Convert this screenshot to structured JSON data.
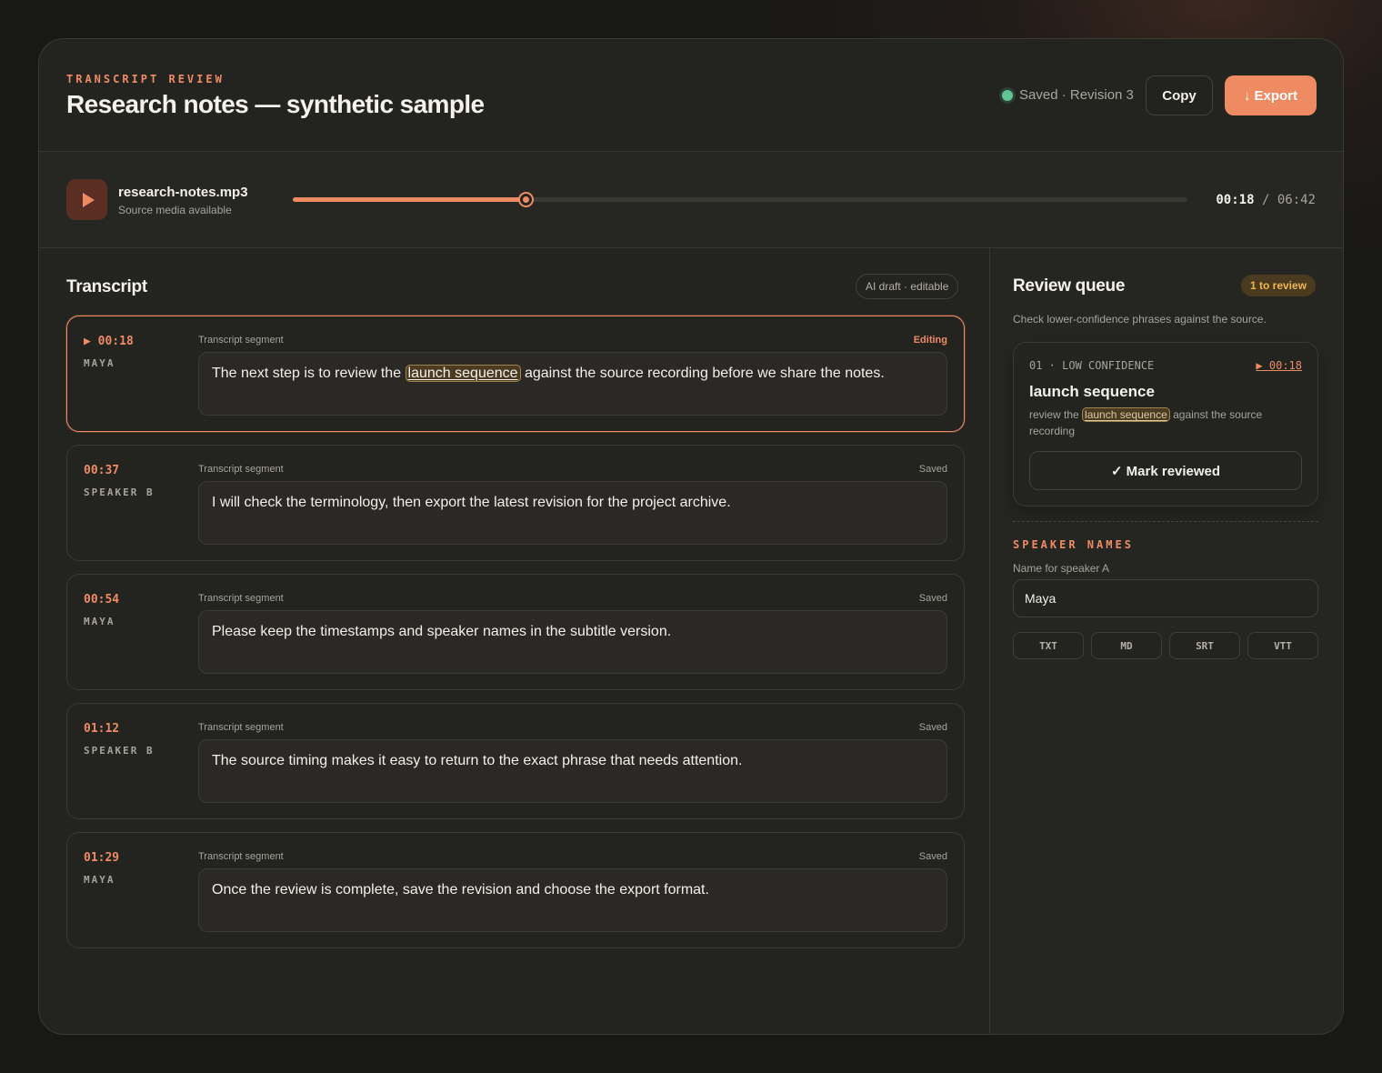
{
  "header": {
    "eyebrow": "TRANSCRIPT REVIEW",
    "title": "Research notes — synthetic sample",
    "status": "Saved · Revision 3",
    "copy_label": "Copy",
    "export_label": "Export",
    "export_icon": "↓"
  },
  "player": {
    "file_name": "research-notes.mp3",
    "file_sub": "Source media available",
    "current_time": "00:18",
    "separator": "/",
    "duration": "06:42",
    "progress_fraction": 0.26
  },
  "transcript": {
    "title": "Transcript",
    "pill": "AI draft · editable",
    "segment_label": "Transcript segment",
    "segments": [
      {
        "time": "▶ 00:18",
        "speaker": "MAYA",
        "state": "Editing",
        "before": "The next step is to review the ",
        "highlight": "launch sequence",
        "after": " against the source recording before we share the notes."
      },
      {
        "time": "00:37",
        "speaker": "SPEAKER B",
        "state": "Saved",
        "before": "I will check the terminology, then export the latest revision for the project archive.",
        "highlight": "",
        "after": ""
      },
      {
        "time": "00:54",
        "speaker": "MAYA",
        "state": "Saved",
        "before": "Please keep the timestamps and speaker names in the subtitle version.",
        "highlight": "",
        "after": ""
      },
      {
        "time": "01:12",
        "speaker": "SPEAKER B",
        "state": "Saved",
        "before": "The source timing makes it easy to return to the exact phrase that needs attention.",
        "highlight": "",
        "after": ""
      },
      {
        "time": "01:29",
        "speaker": "MAYA",
        "state": "Saved",
        "before": "Once the review is complete, save the revision and choose the export format.",
        "highlight": "",
        "after": ""
      }
    ]
  },
  "review": {
    "title": "Review queue",
    "pill": "1 to review",
    "help": "Check lower-confidence phrases against the source.",
    "item": {
      "meta": "01 · LOW CONFIDENCE",
      "time": "▶ 00:18",
      "phrase": "launch sequence",
      "context_before": "review the ",
      "context_highlight": "launch sequence",
      "context_after": " against the source recording",
      "mark_label": "✓ Mark reviewed"
    },
    "speaker_heading": "SPEAKER NAMES",
    "speaker_label": "Name for speaker A",
    "speaker_value": "Maya",
    "formats": [
      "TXT",
      "MD",
      "SRT",
      "VTT"
    ]
  },
  "colors": {
    "accent": "#ef8b63",
    "saved_dot": "#5fc796",
    "review_pill": "#f0b64e"
  }
}
